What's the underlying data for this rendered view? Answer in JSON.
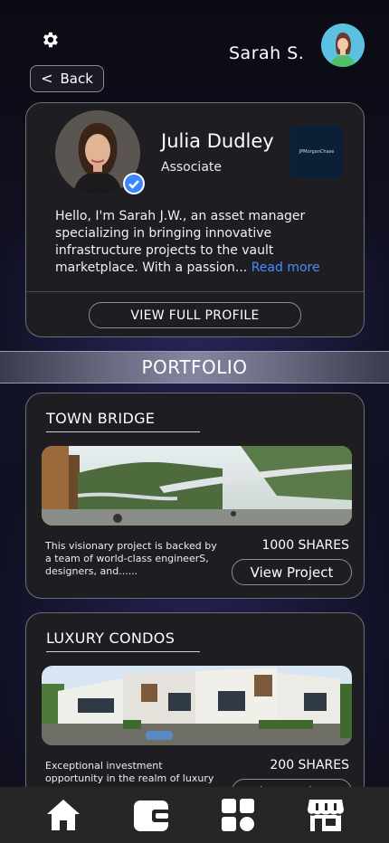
{
  "header": {
    "user_name": "Sarah S.",
    "back_label": "Back"
  },
  "profile": {
    "name": "Julia Dudley",
    "title": "Associate",
    "company": "JPMorganChase",
    "bio": "Hello, I'm Sarah J.W., an asset manager specializing in bringing innovative infrastructure projects to the vault marketplace. With a passion...",
    "read_more": "Read more",
    "view_profile_label": "VIEW FULL PROFILE"
  },
  "portfolio": {
    "heading": "PORTFOLIO",
    "projects": [
      {
        "title": "TOWN BRIDGE",
        "description": "This visionary project is backed by a team of world-class engineerS, designers, and......",
        "shares": "1000 SHARES",
        "button_label": "View Project"
      },
      {
        "title": "LUXURY CONDOS",
        "description": "Exceptional investment opportunity in the realm of luxury living, boasting...",
        "shares": "200 SHARES",
        "button_label": "View Project"
      }
    ]
  },
  "tabbar": {
    "icons": [
      "home-icon",
      "wallet-icon",
      "apps-icon",
      "store-icon"
    ]
  }
}
